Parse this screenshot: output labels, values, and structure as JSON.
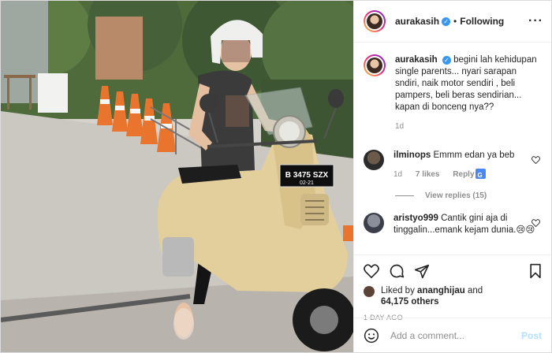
{
  "header": {
    "username": "aurakasih",
    "separator": "•",
    "follow_status": "Following",
    "more_label": "···"
  },
  "caption": {
    "username": "aurakasih",
    "text": "begini lah kehidupan single parents... nyari sarapan sndiri, naik motor sendiri , beli pampers, beli beras sendirian... kapan di bonceng nya??",
    "time": "1d"
  },
  "comments": [
    {
      "username": "ilminops",
      "text": "Emmm edan ya beb",
      "time": "1d",
      "likes": "7 likes",
      "reply_label": "Reply",
      "view_replies": "View replies (15)"
    },
    {
      "username": "aristyo999",
      "text": "Cantik gini aja di tinggalin...emank kejam dunia.😢😢"
    }
  ],
  "likes": {
    "prefix": "Liked by",
    "user": "ananghijau",
    "joiner": "and",
    "count": "64,175 others"
  },
  "timestamp": "1 DAY AGO",
  "add_comment": {
    "placeholder": "Add a comment...",
    "post_label": "Post"
  },
  "photo": {
    "plate": "B 3475 SZX",
    "plate_expiry": "02-21"
  },
  "colors": {
    "verified": "#3897f0",
    "muted": "#8e8e8e",
    "post_button": "#b2dffc",
    "scooter": "#e3cf9c"
  }
}
